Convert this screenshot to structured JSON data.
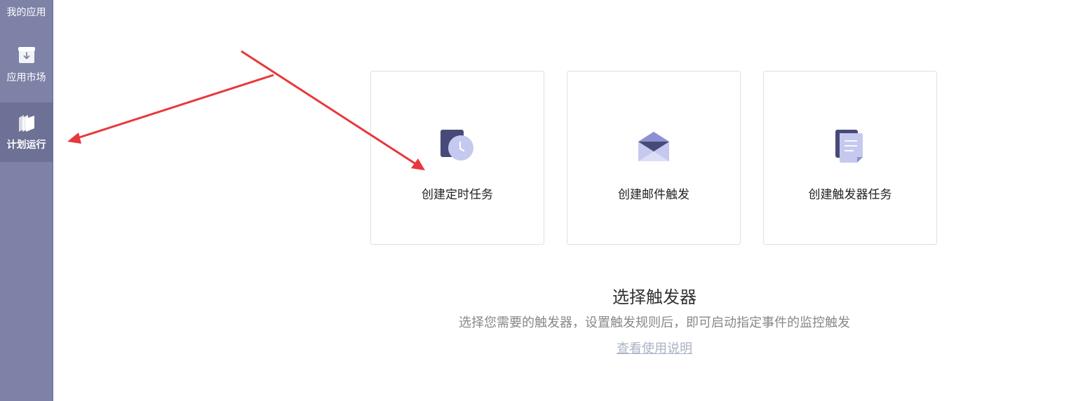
{
  "sidebar": {
    "items": [
      {
        "label": "我的应用",
        "icon": "grid-icon"
      },
      {
        "label": "应用市场",
        "icon": "download-box-icon"
      },
      {
        "label": "计划运行",
        "icon": "stack-icon",
        "active": true
      }
    ]
  },
  "cards": [
    {
      "label": "创建定时任务",
      "icon": "clock-icon"
    },
    {
      "label": "创建邮件触发",
      "icon": "mail-icon"
    },
    {
      "label": "创建触发器任务",
      "icon": "document-icon"
    }
  ],
  "main": {
    "title": "选择触发器",
    "description": "选择您需要的触发器，设置触发规则后，即可启动指定事件的监控触发",
    "help_link": "查看使用说明"
  },
  "colors": {
    "sidebar": "#7d82a6",
    "sidebar_active": "#6c7195",
    "icon_dark": "#474a78",
    "icon_light": "#c5c9ef",
    "annotation_arrow": "#e8383c"
  }
}
